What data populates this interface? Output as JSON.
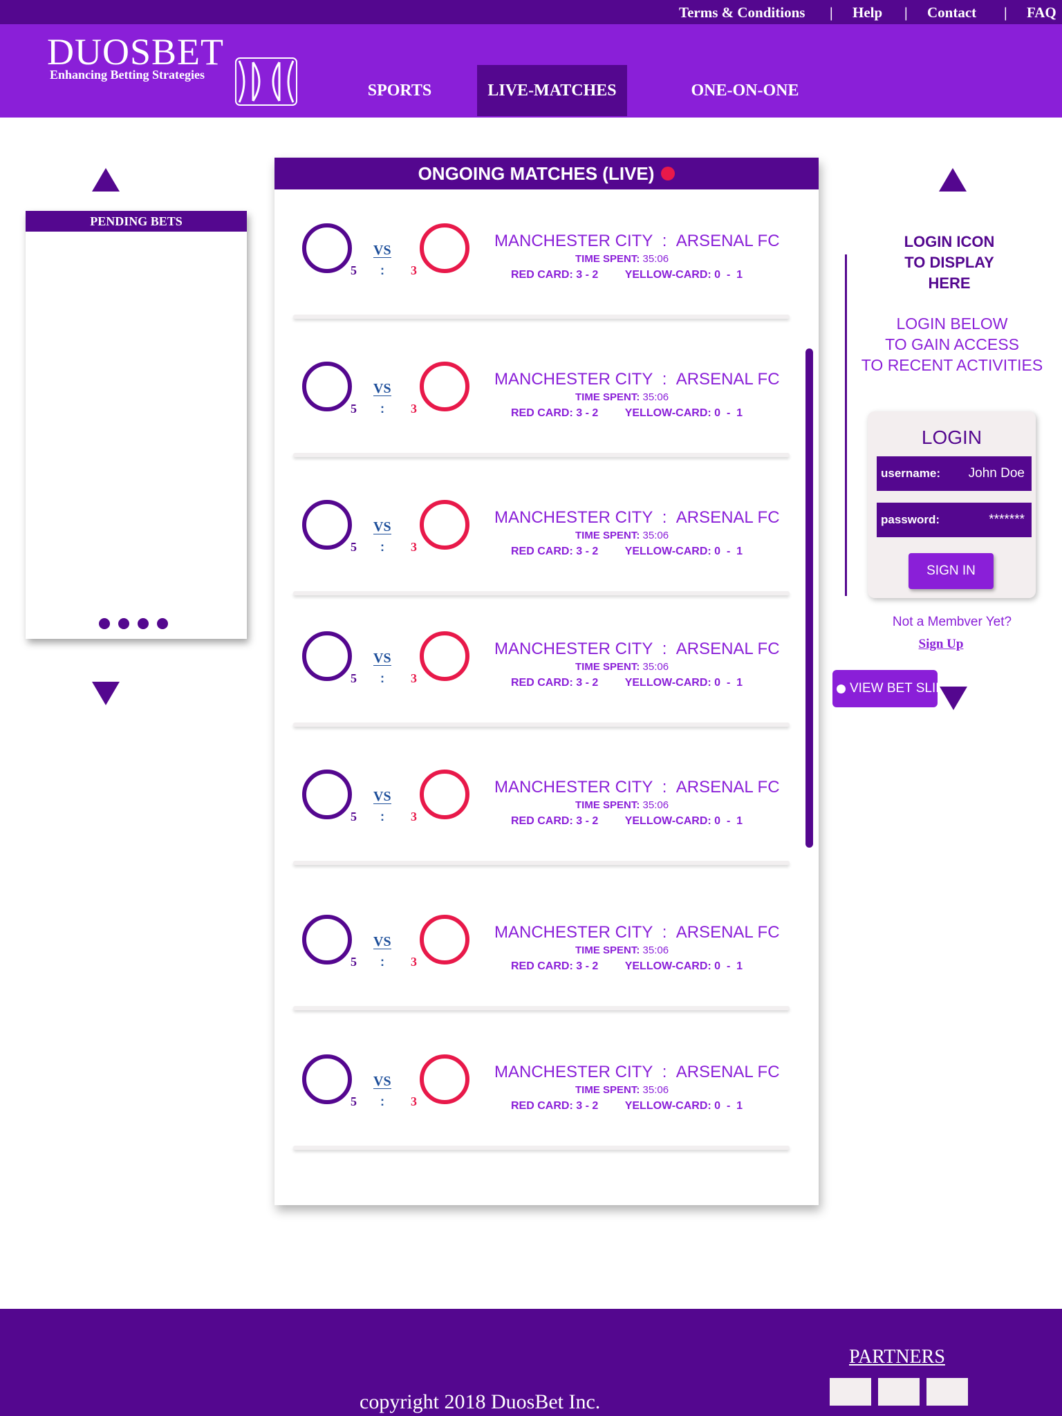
{
  "topbar": {
    "links": [
      "Terms & Conditions",
      "Help",
      "Contact",
      "FAQ"
    ],
    "separator": "|"
  },
  "header": {
    "brand": "DUOSBET",
    "tagline": "Enhancing Betting Strategies",
    "logo_icon": "duosbet-logo-icon",
    "nav": [
      "SPORTS",
      "LIVE-MATCHES",
      "ONE-ON-ONE"
    ],
    "active_nav": "LIVE-MATCHES"
  },
  "pending_bets": {
    "title": "PENDING BETS",
    "page_dots": 4
  },
  "ongoing": {
    "title": "ONGOING MATCHES (LIVE)",
    "matches": [
      {
        "home": "MANCHESTER CITY",
        "away": "ARSENAL FC",
        "team_sep": ":",
        "vs": "VS",
        "score_home": "5",
        "score_sep": ":",
        "score_away": "3",
        "time_label": "TIME SPENT:",
        "time": "35:06",
        "red_label": "RED CARD:",
        "red": "3 - 2",
        "yellow_label": "YELLOW-CARD:",
        "yellow": "0  -  1"
      },
      {
        "home": "MANCHESTER CITY",
        "away": "ARSENAL FC",
        "team_sep": ":",
        "vs": "VS",
        "score_home": "5",
        "score_sep": ":",
        "score_away": "3",
        "time_label": "TIME SPENT:",
        "time": "35:06",
        "red_label": "RED CARD:",
        "red": "3 - 2",
        "yellow_label": "YELLOW-CARD:",
        "yellow": "0  -  1"
      },
      {
        "home": "MANCHESTER CITY",
        "away": "ARSENAL FC",
        "team_sep": ":",
        "vs": "VS",
        "score_home": "5",
        "score_sep": ":",
        "score_away": "3",
        "time_label": "TIME SPENT:",
        "time": "35:06",
        "red_label": "RED CARD:",
        "red": "3 - 2",
        "yellow_label": "YELLOW-CARD:",
        "yellow": "0  -  1"
      },
      {
        "home": "MANCHESTER CITY",
        "away": "ARSENAL FC",
        "team_sep": ":",
        "vs": "VS",
        "score_home": "5",
        "score_sep": ":",
        "score_away": "3",
        "time_label": "TIME SPENT:",
        "time": "35:06",
        "red_label": "RED CARD:",
        "red": "3 - 2",
        "yellow_label": "YELLOW-CARD:",
        "yellow": "0  -  1"
      },
      {
        "home": "MANCHESTER CITY",
        "away": "ARSENAL FC",
        "team_sep": ":",
        "vs": "VS",
        "score_home": "5",
        "score_sep": ":",
        "score_away": "3",
        "time_label": "TIME SPENT:",
        "time": "35:06",
        "red_label": "RED CARD:",
        "red": "3 - 2",
        "yellow_label": "YELLOW-CARD:",
        "yellow": "0  -  1"
      },
      {
        "home": "MANCHESTER CITY",
        "away": "ARSENAL FC",
        "team_sep": ":",
        "vs": "VS",
        "score_home": "5",
        "score_sep": ":",
        "score_away": "3",
        "time_label": "TIME SPENT:",
        "time": "35:06",
        "red_label": "RED CARD:",
        "red": "3 - 2",
        "yellow_label": "YELLOW-CARD:",
        "yellow": "0  -  1"
      },
      {
        "home": "MANCHESTER CITY",
        "away": "ARSENAL FC",
        "team_sep": ":",
        "vs": "VS",
        "score_home": "5",
        "score_sep": ":",
        "score_away": "3",
        "time_label": "TIME SPENT:",
        "time": "35:06",
        "red_label": "RED CARD:",
        "red": "3 - 2",
        "yellow_label": "YELLOW-CARD:",
        "yellow": "0  -  1"
      }
    ]
  },
  "login_panel": {
    "icon_text": [
      "LOGIN ICON",
      "TO DISPLAY",
      "HERE"
    ],
    "prompt": [
      "LOGIN BELOW",
      "TO GAIN ACCESS",
      "TO RECENT ACTIVITIES"
    ],
    "title": "LOGIN",
    "username_label": "username:",
    "username_value": "John Doe",
    "password_label": "password:",
    "password_value": "*******",
    "signin_label": "SIGN IN",
    "not_member": "Not a Membver Yet?",
    "signup_label": "Sign Up",
    "betslip_label": "VIEW BET SLIP"
  },
  "footer": {
    "copyright": "copyright 2018 DuosBet Inc.",
    "partners_title": "PARTNERS",
    "partner_count": 3
  },
  "colors": {
    "primary_dark": "#54078f",
    "primary": "#8a1fd8",
    "accent_red": "#e8194a",
    "vs_blue": "#1e4f9a",
    "panel_grey": "#f3eeef"
  }
}
